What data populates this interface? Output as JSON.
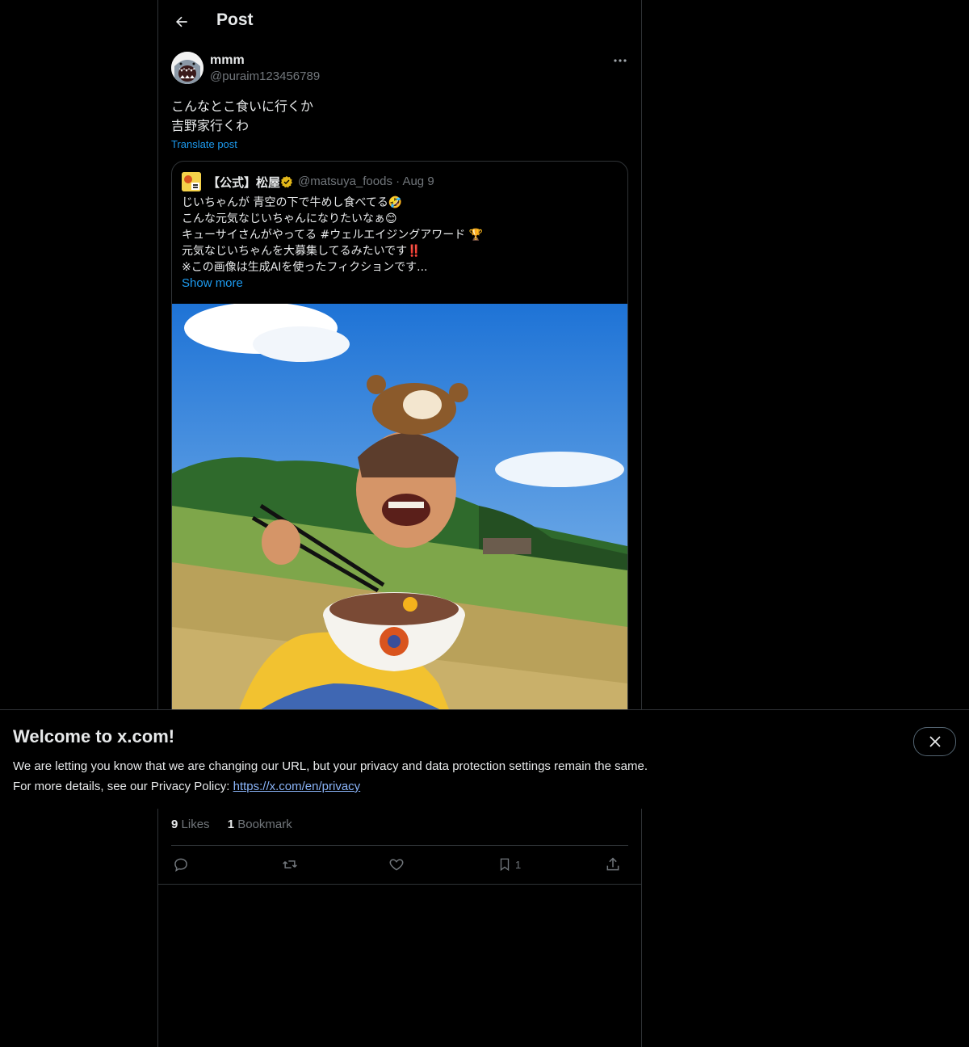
{
  "header": {
    "title": "Post"
  },
  "post": {
    "author_name": "mmm",
    "author_handle": "@puraim123456789",
    "text_lines": [
      "こんなとこ食いに行くか",
      "吉野家行くわ"
    ],
    "translate_label": "Translate post"
  },
  "quote": {
    "name": "【公式】松屋",
    "handle_date": "@matsuya_foods · Aug 9",
    "lines": [
      "じいちゃんが 青空の下で牛めし食べてる🤣",
      "こんな元気なじいちゃんになりたいなぁ😊",
      "キューサイさんがやってる #ウェルエイジングアワード 🏆",
      "元気なじいちゃんを大募集してるみたいです‼️",
      "※この画像は生成AIを使ったフィクションです..."
    ],
    "show_more": "Show more"
  },
  "stats": {
    "likes_count": "9",
    "likes_label": "Likes",
    "bookmarks_count": "1",
    "bookmarks_label": "Bookmark"
  },
  "actions": {
    "bookmark_count": "1"
  },
  "banner": {
    "title": "Welcome to x.com!",
    "line1": "We are letting you know that we are changing our URL, but your privacy and data protection settings remain the same.",
    "line2_prefix": "For more details, see our Privacy Policy:",
    "link": "https://x.com/en/privacy"
  },
  "colors": {
    "accent": "#1d9bf0",
    "background": "#000000",
    "border": "#2f3336",
    "muted": "#71767b"
  }
}
